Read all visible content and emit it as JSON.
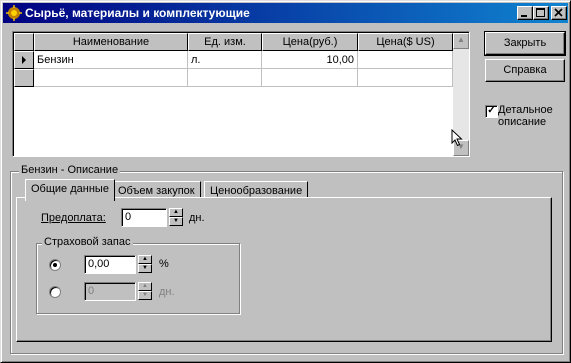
{
  "window": {
    "title": "Сырьё, материалы и комплектующие"
  },
  "grid": {
    "columns": [
      "Наименование",
      "Ед. изм.",
      "Цена(руб.)",
      "Цена($ US)"
    ],
    "rows": [
      {
        "name": "Бензин",
        "unit": "л.",
        "price_rub": "10,00",
        "price_usd": ""
      }
    ]
  },
  "buttons": {
    "close": "Закрыть",
    "help": "Справка"
  },
  "detail_checkbox": {
    "label_line1": "Детальное",
    "label_line2": "описание",
    "checked": true
  },
  "group": {
    "label": "Бензин - Описание"
  },
  "tabs": [
    "Общие данные",
    "Объем закупок",
    "Ценообразование"
  ],
  "general": {
    "prepayment_label": "Предоплата:",
    "prepayment_value": "0",
    "prepayment_unit": "дн.",
    "reserve": {
      "label": "Страховой запас",
      "percent_value": "0,00",
      "percent_unit": "%",
      "days_value": "0",
      "days_unit": "дн."
    }
  },
  "colors": {
    "titlebar_start": "#000080",
    "titlebar_end": "#1084d0",
    "face": "#c0c0c0"
  }
}
